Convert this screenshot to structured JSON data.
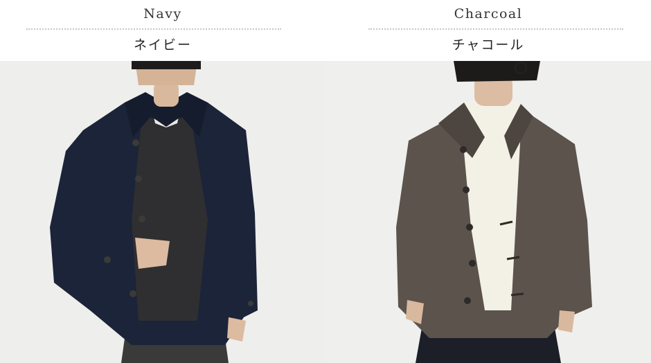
{
  "variants": [
    {
      "name_en": "Navy",
      "name_jp": "ネイビー",
      "photo_alt": "model wearing navy coat",
      "coat_color": "#1b2438",
      "inner_color": "#2f2f31",
      "shirt_color": "#e9e9e9",
      "bg_color": "#eeeeec"
    },
    {
      "name_en": "Charcoal",
      "name_jp": "チャコール",
      "photo_alt": "model wearing charcoal coat",
      "coat_color": "#5b534c",
      "inner_color": "#f3f0e6",
      "shirt_color": "#f3f0e6",
      "bg_color": "#efefed"
    }
  ]
}
